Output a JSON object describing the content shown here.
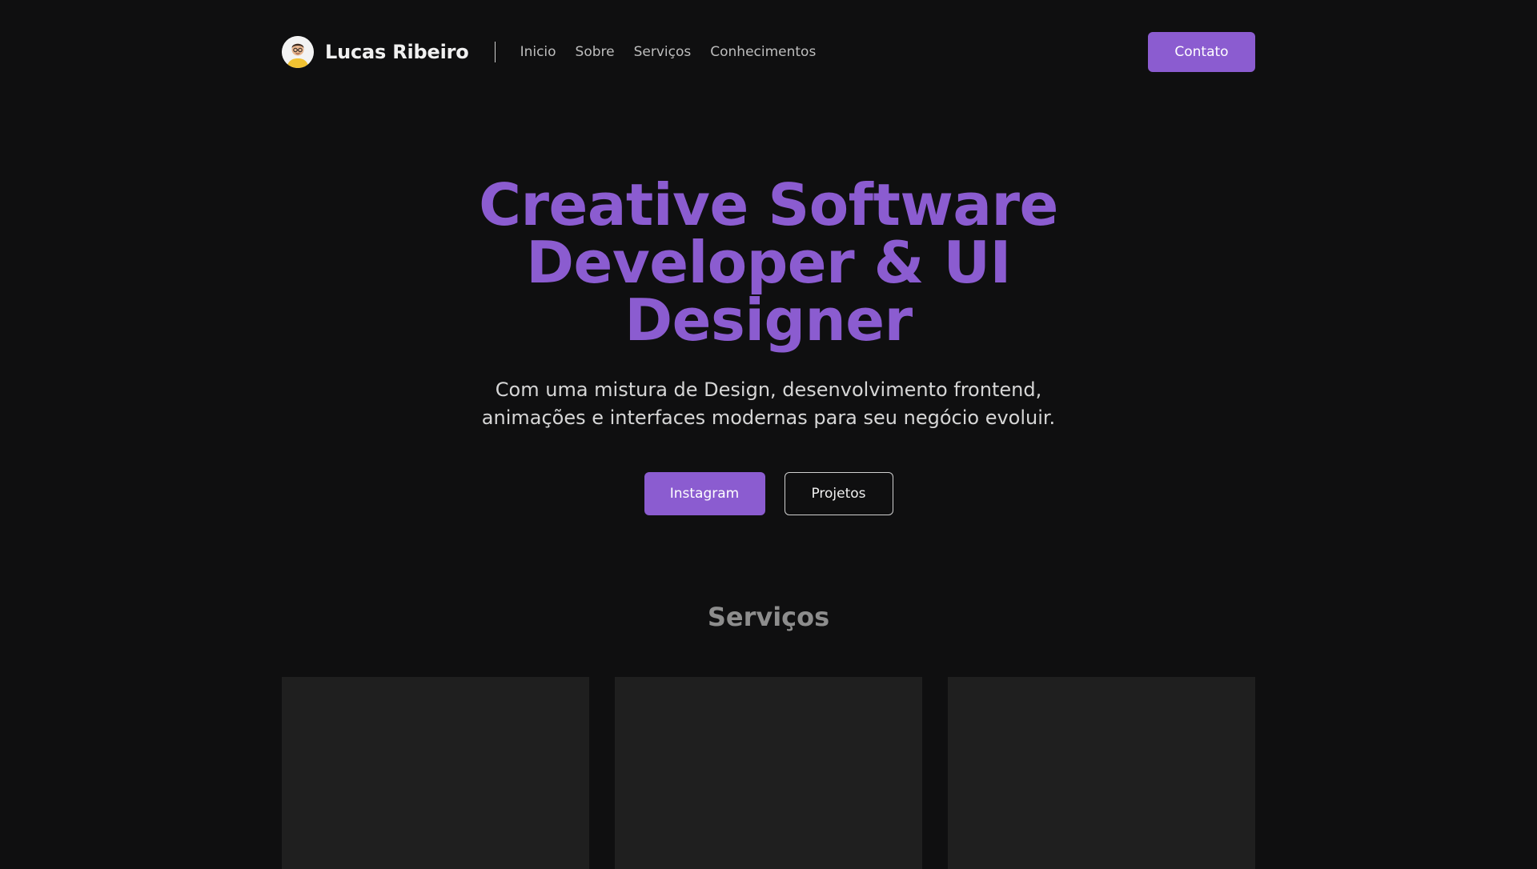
{
  "header": {
    "brand_name": "Lucas Ribeiro",
    "avatar_icon": "person-avatar-icon",
    "nav": [
      {
        "label": "Inicio"
      },
      {
        "label": "Sobre"
      },
      {
        "label": "Serviços"
      },
      {
        "label": "Conhecimentos"
      }
    ],
    "contact_label": "Contato"
  },
  "hero": {
    "title": "Creative Software Developer & UI Designer",
    "subtitle": "Com uma mistura de Design, desenvolvimento frontend, animações e interfaces modernas para seu negócio evoluir.",
    "primary_action": "Instagram",
    "secondary_action": "Projetos"
  },
  "services": {
    "title": "Serviços",
    "card_count": 3
  },
  "colors": {
    "background": "#0f0f10",
    "accent": "#8b5cd0",
    "card": "#1f1f1f",
    "muted_heading": "#8d8d8d"
  }
}
